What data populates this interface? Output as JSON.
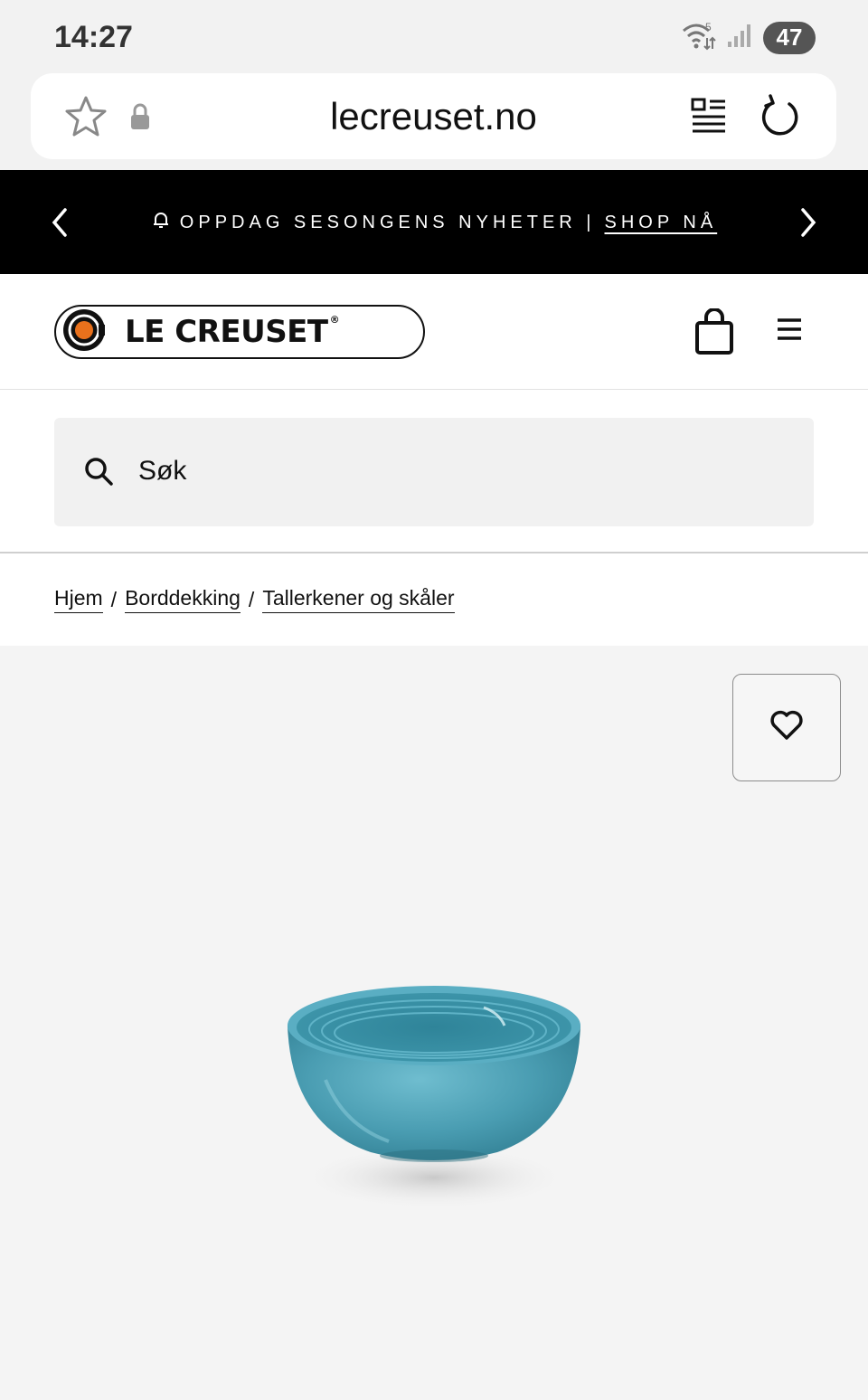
{
  "status_bar": {
    "time": "14:27",
    "battery": "47",
    "network_label": "5"
  },
  "browser": {
    "url": "lecreuset.no"
  },
  "promo": {
    "text": "OPPDAG SESONGENS NYHETER |",
    "link": "SHOP NÅ"
  },
  "header": {
    "logo_text": "LE CREUSET",
    "logo_reg": "®"
  },
  "search": {
    "placeholder": "Søk"
  },
  "breadcrumb": {
    "items": [
      "Hjem",
      "Borddekking",
      "Tallerkener og skåler"
    ],
    "separator": "/"
  },
  "product": {
    "color": "#4b9fb3",
    "image_alt": "turquoise-bowl"
  },
  "colors": {
    "logo_orange": "#e9711c",
    "banner_bg": "#000000"
  }
}
